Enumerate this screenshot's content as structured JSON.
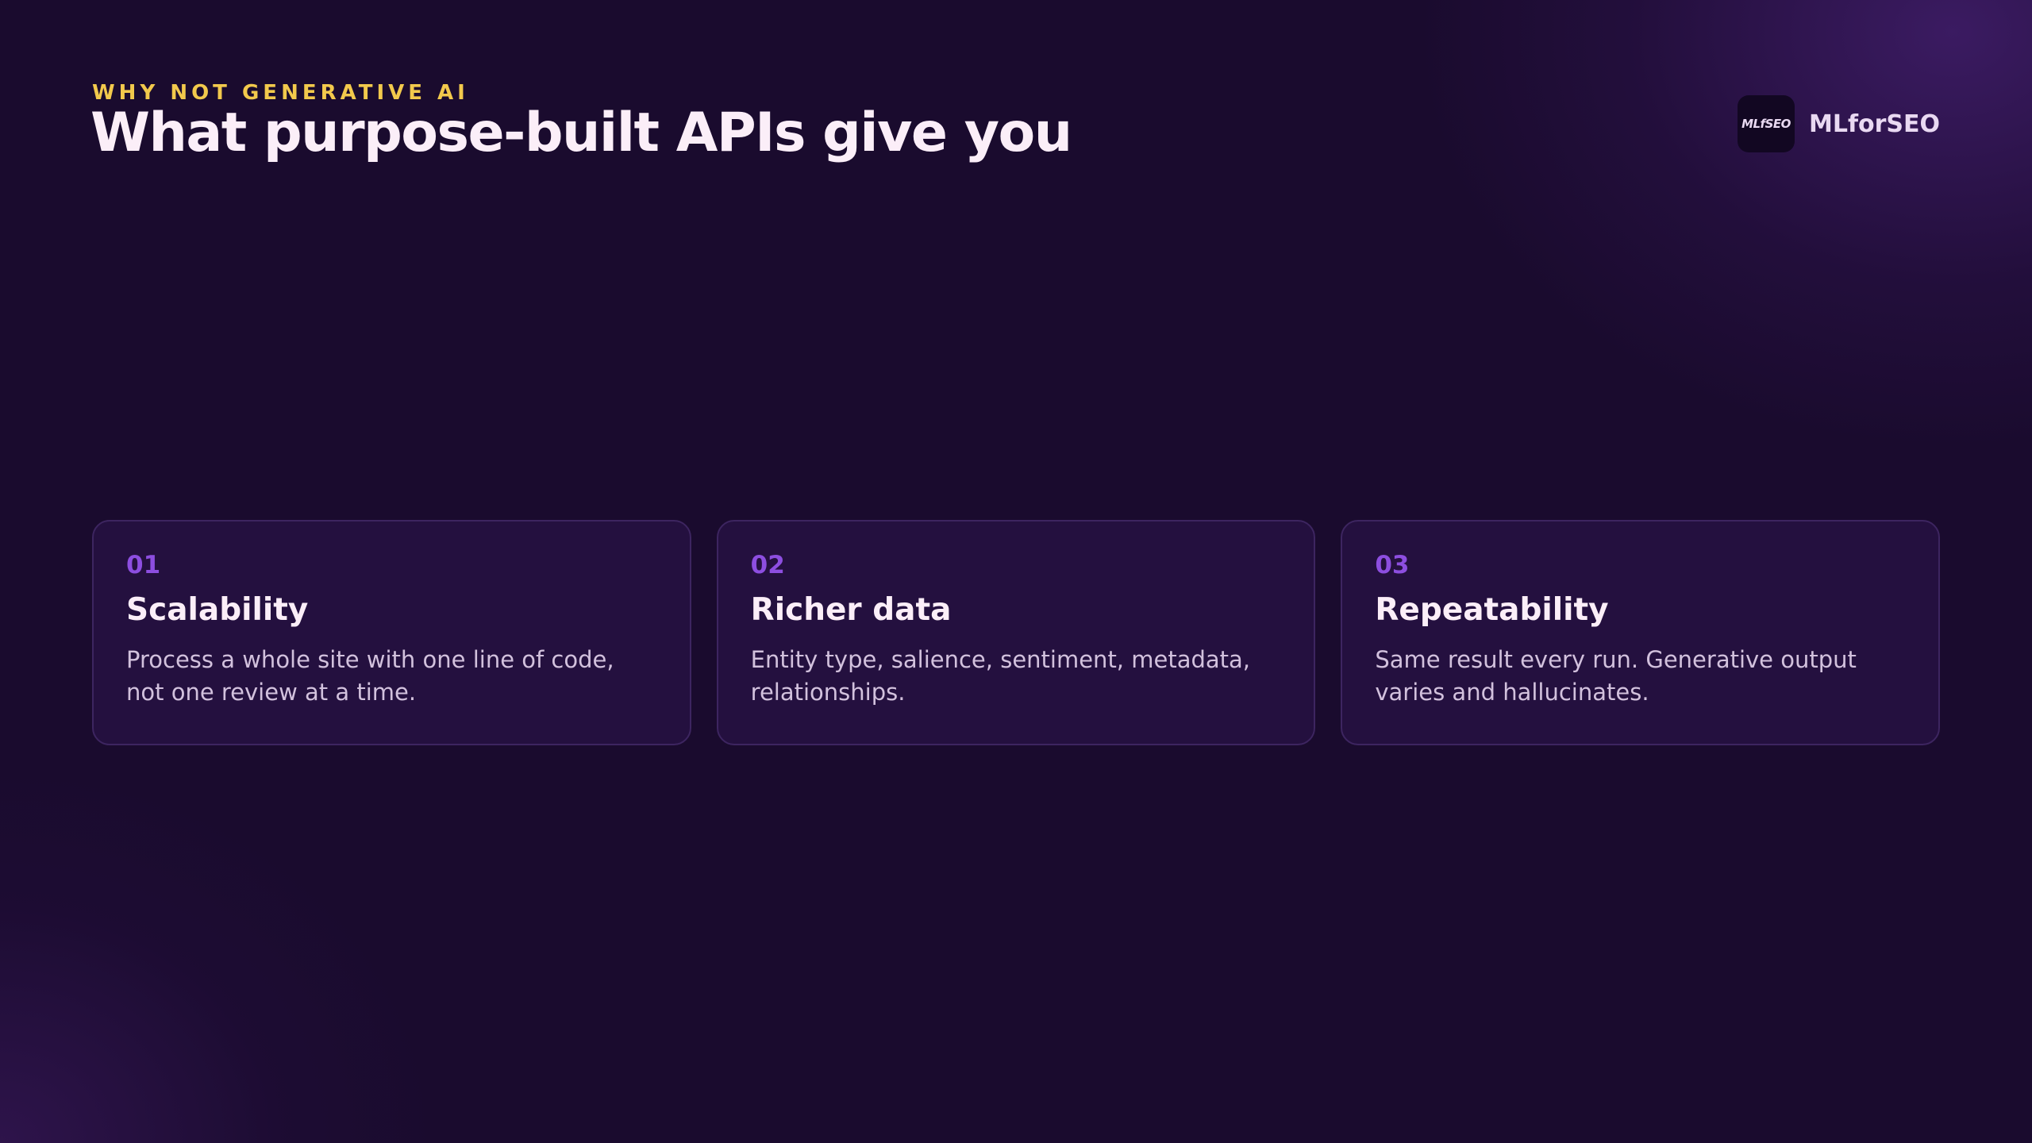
{
  "header": {
    "eyebrow": "WHY NOT GENERATIVE AI",
    "title": "What purpose-built APIs give you"
  },
  "brand": {
    "logo_text": "MLfSEO",
    "name": "MLforSEO"
  },
  "cards": [
    {
      "number": "01",
      "title": "Scalability",
      "description": "Process a whole site with one line of code, not one review at a time."
    },
    {
      "number": "02",
      "title": "Richer data",
      "description": "Entity type, salience, sentiment, metadata, relationships."
    },
    {
      "number": "03",
      "title": "Repeatability",
      "description": "Same result every run. Generative output varies and hallucinates."
    }
  ],
  "colors": {
    "background": "#1a0b2e",
    "eyebrow": "#f2c94c",
    "accent": "#8d4ee0",
    "card_background": "#24103f",
    "card_border": "#3d2560"
  }
}
